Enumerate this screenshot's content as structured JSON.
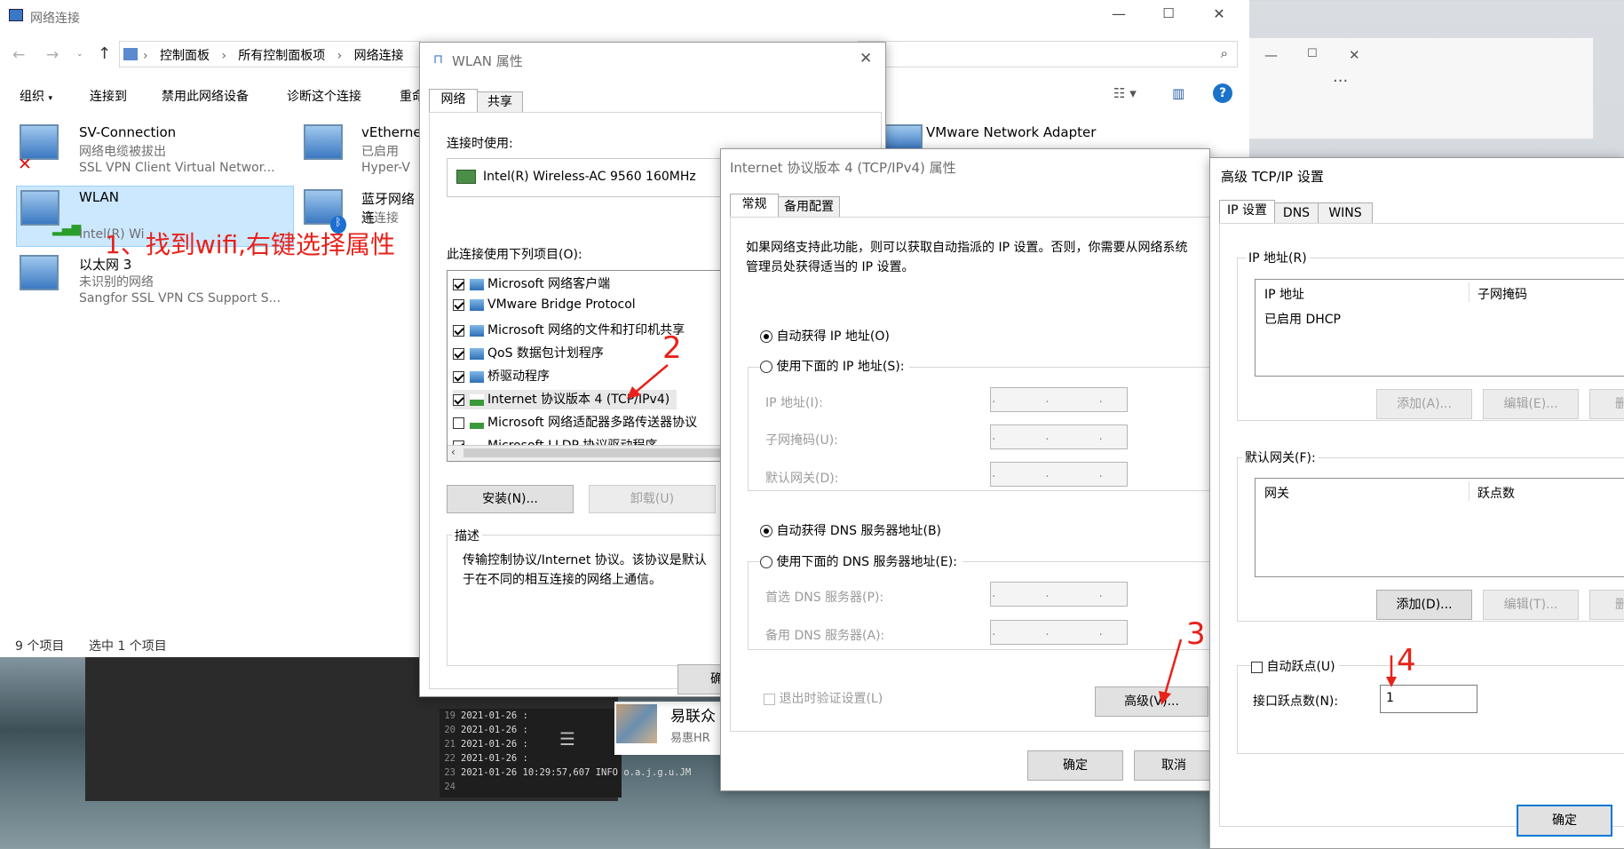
{
  "explorer": {
    "title": "网络连接",
    "breadcrumb": [
      "控制面板",
      "所有控制面板项",
      "网络连接"
    ],
    "toolbar": [
      "组织",
      "连接到",
      "禁用此网络设备",
      "诊断这个连接",
      "重命"
    ],
    "connections": [
      {
        "name": "SV-Connection",
        "status": "网络电缆被拔出",
        "device": "SSL VPN Client Virtual Networ..."
      },
      {
        "name": "vEtherne",
        "status": "已启用",
        "device": "Hyper-V"
      },
      {
        "name": "WLAN",
        "status": "",
        "device": "Intel(R) Wi"
      },
      {
        "name": "蓝牙网络连",
        "status": "未连接",
        "device": ""
      },
      {
        "name": "以太网 3",
        "status": "未识别的网络",
        "device": "Sangfor SSL VPN CS Support S..."
      },
      {
        "name": "VMware Network Adapter",
        "status": "",
        "device": ""
      }
    ],
    "status_count": "9 个项目",
    "status_selected": "选中 1 个项目"
  },
  "wlan_props": {
    "title": "WLAN 属性",
    "tabs": [
      "网络",
      "共享"
    ],
    "connect_using_label": "连接时使用:",
    "adapter": "Intel(R) Wireless-AC 9560 160MHz",
    "items_label": "此连接使用下列项目(O):",
    "items": [
      {
        "label": "Microsoft 网络客户端",
        "checked": true
      },
      {
        "label": "VMware Bridge Protocol",
        "checked": true
      },
      {
        "label": "Microsoft 网络的文件和打印机共享",
        "checked": true
      },
      {
        "label": "QoS 数据包计划程序",
        "checked": true
      },
      {
        "label": "桥驱动程序",
        "checked": true
      },
      {
        "label": "Internet 协议版本 4 (TCP/IPv4)",
        "checked": true
      },
      {
        "label": "Microsoft 网络适配器多路传送器协议",
        "checked": false
      },
      {
        "label": "Microsoft LLDP 协议驱动程序",
        "checked": true
      }
    ],
    "install_button": "安装(N)...",
    "uninstall_button": "卸载(U)",
    "description_title": "描述",
    "description_text": "传输控制协议/Internet 协议。该协议是默认\n于在不同的相互连接的网络上通信。",
    "ok_partial": "确"
  },
  "ipv4_props": {
    "title": "Internet 协议版本 4 (TCP/IPv4) 属性",
    "tabs": [
      "常规",
      "备用配置"
    ],
    "intro": "如果网络支持此功能，则可以获取自动指派的 IP 设置。否则，你需要从网络系统管理员处获得适当的 IP 设置。",
    "auto_ip": "自动获得 IP 地址(O)",
    "manual_ip": "使用下面的 IP 地址(S):",
    "ip_label": "IP 地址(I):",
    "mask_label": "子网掩码(U):",
    "gateway_label": "默认网关(D):",
    "auto_dns": "自动获得 DNS 服务器地址(B)",
    "manual_dns": "使用下面的 DNS 服务器地址(E):",
    "dns1_label": "首选 DNS 服务器(P):",
    "dns2_label": "备用 DNS 服务器(A):",
    "ip_placeholder": ". . .",
    "validate_label": "退出时验证设置(L)",
    "advanced_button": "高级(V)...",
    "ok_button": "确定",
    "cancel_button": "取消"
  },
  "advanced_tcpip": {
    "title": "高级 TCP/IP 设置",
    "tabs": [
      "IP 设置",
      "DNS",
      "WINS"
    ],
    "ip_group_title": "IP 地址(R)",
    "ip_col": "IP 地址",
    "mask_col": "子网掩码",
    "dhcp_text": "已启用 DHCP",
    "add_button": "添加(A)...",
    "edit_button": "编辑(E)...",
    "delete_partial": "删",
    "gateway_group_title": "默认网关(F):",
    "gateway_col": "网关",
    "metric_col": "跃点数",
    "gw_add_button": "添加(D)...",
    "gw_edit_button": "编辑(T)...",
    "auto_metric_label": "自动跃点(U)",
    "interface_metric_label": "接口跃点数(N):",
    "interface_metric_value": "1",
    "ok_button": "确定"
  },
  "bg_window": {
    "icons": [
      "pin-icon",
      "minimize-icon",
      "maximize-icon",
      "close-icon"
    ],
    "more": "···"
  },
  "terminal": {
    "lines": [
      {
        "num": "19",
        "text": "2021-01-26 :"
      },
      {
        "num": "20",
        "text": "2021-01-26 :"
      },
      {
        "num": "21",
        "text": "2021-01-26 :"
      },
      {
        "num": "22",
        "text": "2021-01-26 :"
      },
      {
        "num": "23",
        "text": "2021-01-26 10:29:57,607 INFO o.a.j.g.u.JM"
      },
      {
        "num": "24",
        "text": ""
      }
    ]
  },
  "chat_snippet": {
    "name": "易联众",
    "sub": "易惠HR"
  },
  "annotations": {
    "step1": "1、找到wifi,右键选择属性",
    "step2": "2",
    "step3": "3",
    "step4": "4"
  },
  "colors": {
    "accent": "#0078d7",
    "annotation_red": "#e8221b",
    "selection": "#cce8ff"
  }
}
